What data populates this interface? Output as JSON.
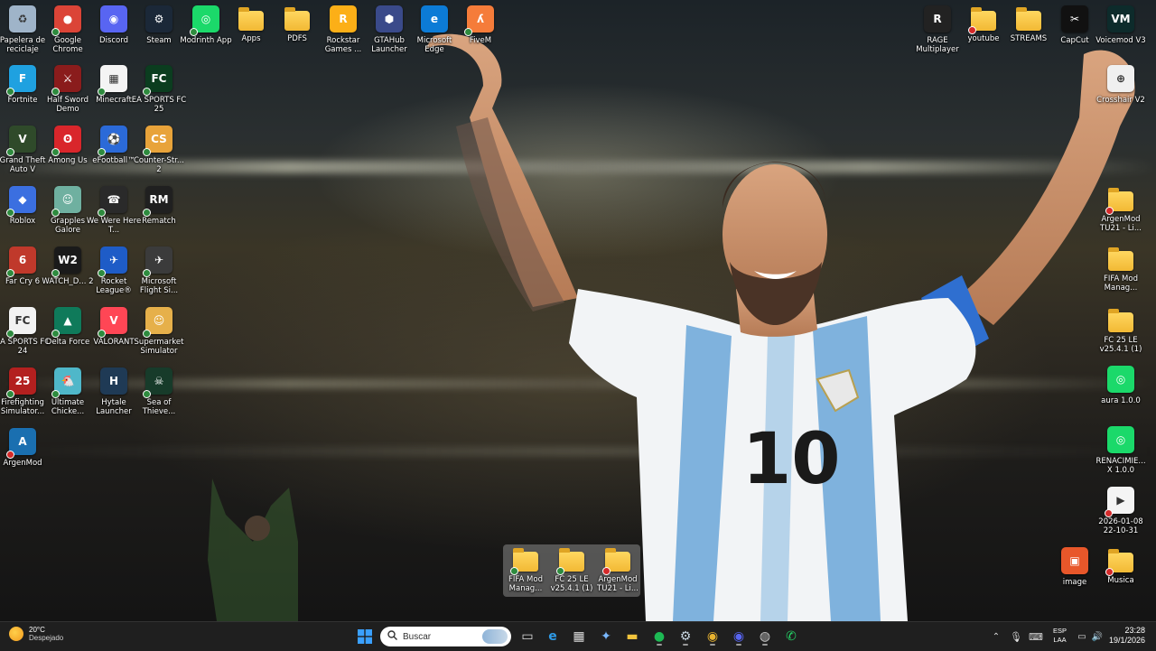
{
  "desktop_left": [
    {
      "name": "recycle-bin-icon",
      "label": "Papelera de reciclaje",
      "glyph": "♻",
      "bg": "#9fb4c9",
      "badge": ""
    },
    {
      "name": "chrome-icon",
      "label": "Google Chrome",
      "glyph": "●",
      "bg": "#db4437",
      "badge": "ok"
    },
    {
      "name": "discord-icon",
      "label": "Discord",
      "glyph": "◉",
      "bg": "#5865f2",
      "badge": ""
    },
    {
      "name": "steam-icon",
      "label": "Steam",
      "glyph": "⚙",
      "bg": "#1b2838",
      "badge": ""
    },
    {
      "name": "modrinth-icon",
      "label": "Modrinth App",
      "glyph": "◎",
      "bg": "#1bd96a",
      "badge": "ok"
    },
    {
      "name": "apps-folder-icon",
      "label": "Apps",
      "glyph": "",
      "bg": "folder",
      "badge": ""
    },
    {
      "name": "pdfs-folder-icon",
      "label": "PDFS",
      "glyph": "",
      "bg": "folder",
      "badge": ""
    },
    {
      "name": "rockstar-icon",
      "label": "Rockstar Games ...",
      "glyph": "R",
      "bg": "#fcaf17",
      "badge": ""
    },
    {
      "name": "gtahub-icon",
      "label": "GTAHub Launcher",
      "glyph": "⬢",
      "bg": "#3a4a8a",
      "badge": ""
    },
    {
      "name": "edge-icon",
      "label": "Microsoft Edge",
      "glyph": "e",
      "bg": "#0c7bd6",
      "badge": ""
    },
    {
      "name": "fivem-icon",
      "label": "FiveM",
      "glyph": "ʎ",
      "bg": "#f57c3a",
      "badge": "ok"
    }
  ],
  "desktop_grid": [
    [
      {
        "name": "fortnite-icon",
        "label": "Fortnite",
        "glyph": "F",
        "bg": "#1fa1e0",
        "badge": "ok"
      },
      {
        "name": "half-sword-icon",
        "label": "Half Sword Demo",
        "glyph": "⚔",
        "bg": "#8a1c1c",
        "badge": "ok"
      },
      {
        "name": "minecraft-icon",
        "label": "Minecraft",
        "glyph": "▦",
        "bg": "#f4f4f4",
        "badge": "ok"
      },
      {
        "name": "ea-fc25-icon",
        "label": "EA SPORTS FC 25",
        "glyph": "FC",
        "bg": "#0b3d1f",
        "badge": "ok"
      }
    ],
    [
      {
        "name": "gta-v-icon",
        "label": "Grand Theft Auto V",
        "glyph": "V",
        "bg": "#2f4a2a",
        "badge": "ok"
      },
      {
        "name": "among-us-icon",
        "label": "Among Us",
        "glyph": "ʘ",
        "bg": "#d9262b",
        "badge": "ok"
      },
      {
        "name": "efootball-icon",
        "label": "eFootball™",
        "glyph": "⚽",
        "bg": "#2b6ad8",
        "badge": "ok"
      },
      {
        "name": "counter-strike-icon",
        "label": "Counter-Str... 2",
        "glyph": "CS",
        "bg": "#e8a33a",
        "badge": "ok"
      }
    ],
    [
      {
        "name": "roblox-icon",
        "label": "Roblox",
        "glyph": "◆",
        "bg": "#3b6fe0",
        "badge": "ok"
      },
      {
        "name": "grapples-galore-icon",
        "label": "Grapples Galore",
        "glyph": "☺",
        "bg": "#6fb0a0",
        "badge": "ok"
      },
      {
        "name": "we-were-here-icon",
        "label": "We Were Here T...",
        "glyph": "☎",
        "bg": "#2a2a2a",
        "badge": "ok"
      },
      {
        "name": "rematch-icon",
        "label": "Rematch",
        "glyph": "RM",
        "bg": "#202020",
        "badge": "ok"
      }
    ],
    [
      {
        "name": "far-cry-icon",
        "label": "Far Cry 6",
        "glyph": "6",
        "bg": "#c0392b",
        "badge": "ok"
      },
      {
        "name": "watch-dogs-icon",
        "label": "WATCH_D... 2",
        "glyph": "W2",
        "bg": "#1a1a1a",
        "badge": "ok"
      },
      {
        "name": "rocket-league-icon",
        "label": "Rocket League®",
        "glyph": "✈",
        "bg": "#1e5cc7",
        "badge": "ok"
      },
      {
        "name": "flight-sim-icon",
        "label": "Microsoft Flight Si...",
        "glyph": "✈",
        "bg": "#3b3b3b",
        "badge": "ok"
      }
    ],
    [
      {
        "name": "ea-fc24-icon",
        "label": "EA SPORTS FC 24",
        "glyph": "FC",
        "bg": "#f2f2f2",
        "badge": "ok"
      },
      {
        "name": "delta-force-icon",
        "label": "Delta Force",
        "glyph": "▲",
        "bg": "#0f7a5a",
        "badge": "ok"
      },
      {
        "name": "valorant-icon",
        "label": "VALORANT",
        "glyph": "V",
        "bg": "#ff4655",
        "badge": "ok"
      },
      {
        "name": "supermarket-sim-icon",
        "label": "Supermarket Simulator",
        "glyph": "☺",
        "bg": "#e6b04a",
        "badge": "ok"
      }
    ],
    [
      {
        "name": "firefighting-sim-icon",
        "label": "Firefighting Simulator...",
        "glyph": "25",
        "bg": "#b3201f",
        "badge": "ok"
      },
      {
        "name": "ultimate-chicken-icon",
        "label": "Ultimate Chicke...",
        "glyph": "🐔",
        "bg": "#4fb7c9",
        "badge": "ok"
      },
      {
        "name": "hytale-icon",
        "label": "Hytale Launcher",
        "glyph": "H",
        "bg": "#1f3a55",
        "badge": ""
      },
      {
        "name": "sea-of-thieves-icon",
        "label": "Sea of Thieve...",
        "glyph": "☠",
        "bg": "#173b2a",
        "badge": "ok"
      }
    ],
    [
      {
        "name": "argenmod-icon",
        "label": "ArgenMod",
        "glyph": "A",
        "bg": "#1a6fb0",
        "badge": "err"
      }
    ]
  ],
  "desktop_right_top": [
    {
      "name": "rage-mp-icon",
      "label": "RAGE Multiplayer",
      "glyph": "R",
      "bg": "#222",
      "badge": ""
    },
    {
      "name": "youtube-folder-icon",
      "label": "youtube",
      "glyph": "",
      "bg": "folder",
      "badge": "err"
    },
    {
      "name": "streams-folder-icon",
      "label": "STREAMS",
      "glyph": "",
      "bg": "folder",
      "badge": ""
    },
    {
      "name": "capcut-icon",
      "label": "CapCut",
      "glyph": "✂",
      "bg": "#111",
      "badge": ""
    },
    {
      "name": "voicemod-icon",
      "label": "Voicemod V3",
      "glyph": "VM",
      "bg": "#0d2b2b",
      "badge": ""
    }
  ],
  "desktop_right_col": [
    {
      "name": "crosshair-icon",
      "label": "Crosshair V2",
      "glyph": "⊕",
      "bg": "#f0f0f0",
      "badge": ""
    },
    {
      "name": "argenmod-folder-icon",
      "label": "ArgenMod TU21 - Li...",
      "glyph": "",
      "bg": "folder",
      "badge": "err"
    },
    {
      "name": "fifa-mod-folder-icon",
      "label": "FIFA Mod Manag...",
      "glyph": "",
      "bg": "folder",
      "badge": ""
    },
    {
      "name": "fc25-le-folder-icon",
      "label": "FC 25 LE v25.4.1 (1)",
      "glyph": "",
      "bg": "folder",
      "badge": ""
    },
    {
      "name": "aura-icon",
      "label": "aura 1.0.0",
      "glyph": "◎",
      "bg": "#1bd96a",
      "badge": ""
    },
    {
      "name": "renacimiento-icon",
      "label": "RENACIMIE... X 1.0.0",
      "glyph": "◎",
      "bg": "#1bd96a",
      "badge": ""
    },
    {
      "name": "video-file-icon",
      "label": "2026-01-08 22-10-31",
      "glyph": "▶",
      "bg": "#f4f4f4",
      "badge": "err"
    },
    {
      "name": "musica-folder-icon",
      "label": "Musica",
      "glyph": "",
      "bg": "folder",
      "badge": "err"
    }
  ],
  "image_file": {
    "name": "image-file-icon",
    "label": "image",
    "glyph": "▣",
    "bg": "#e8572a",
    "badge": ""
  },
  "popup_items": [
    {
      "name": "popup-fifa-mod-folder",
      "label": "FIFA Mod Manag...",
      "badge": "ok"
    },
    {
      "name": "popup-fc25-le-folder",
      "label": "FC 25 LE v25.4.1 (1)",
      "badge": "ok"
    },
    {
      "name": "popup-argenmod-folder",
      "label": "ArgenMod TU21 - Li...",
      "badge": "err"
    }
  ],
  "taskbar": {
    "weather_temp": "20°C",
    "weather_desc": "Despejado",
    "search_placeholder": "Buscar",
    "lang_top": "ESP",
    "lang_bottom": "LAA",
    "time": "23:28",
    "date": "19/1/2026",
    "apps": [
      {
        "name": "start-button",
        "glyph": "⊞",
        "color": "#3aa0ff"
      },
      {
        "name": "task-view-button",
        "glyph": "▭",
        "color": "#ddd"
      },
      {
        "name": "taskbar-edge",
        "glyph": "e",
        "color": "#2e9be8"
      },
      {
        "name": "taskbar-store",
        "glyph": "▦",
        "color": "#ddd"
      },
      {
        "name": "taskbar-copilot",
        "glyph": "✦",
        "color": "#7ab8ff"
      },
      {
        "name": "taskbar-explorer",
        "glyph": "▬",
        "color": "#f2c43d"
      },
      {
        "name": "taskbar-spotify",
        "glyph": "●",
        "color": "#1db954"
      },
      {
        "name": "taskbar-steam",
        "glyph": "⚙",
        "color": "#c7d5e0"
      },
      {
        "name": "taskbar-chrome",
        "glyph": "◉",
        "color": "#e8b330"
      },
      {
        "name": "taskbar-discord",
        "glyph": "◉",
        "color": "#5865f2"
      },
      {
        "name": "taskbar-obs",
        "glyph": "◍",
        "color": "#cccccc"
      },
      {
        "name": "taskbar-whatsapp",
        "glyph": "✆",
        "color": "#25d366"
      }
    ]
  }
}
